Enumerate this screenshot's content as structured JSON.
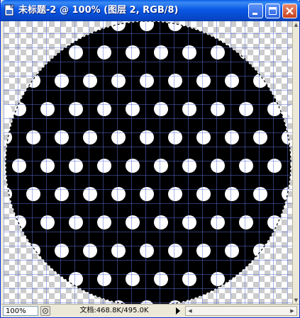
{
  "window": {
    "title": "未标题-2 @ 100% (图层 2, RGB/8)"
  },
  "title_buttons": {
    "minimize_icon": "minimize-icon",
    "maximize_icon": "maximize-icon",
    "close_icon": "close-icon"
  },
  "canvas": {
    "layer_content": "black circle with white polka dots, selected (marching ants)",
    "grid_color": "#5a6fd8",
    "fill_color": "#000000",
    "dot_color": "#ffffff",
    "transparency_checker": [
      "#ffffff",
      "#cccccc"
    ]
  },
  "status_bar": {
    "zoom": "100%",
    "doc_info": "文档:468.8K/495.0K"
  },
  "colors": {
    "titlebar": "#0a58e4",
    "close_button": "#c9401f",
    "chrome": "#ece9d8"
  }
}
